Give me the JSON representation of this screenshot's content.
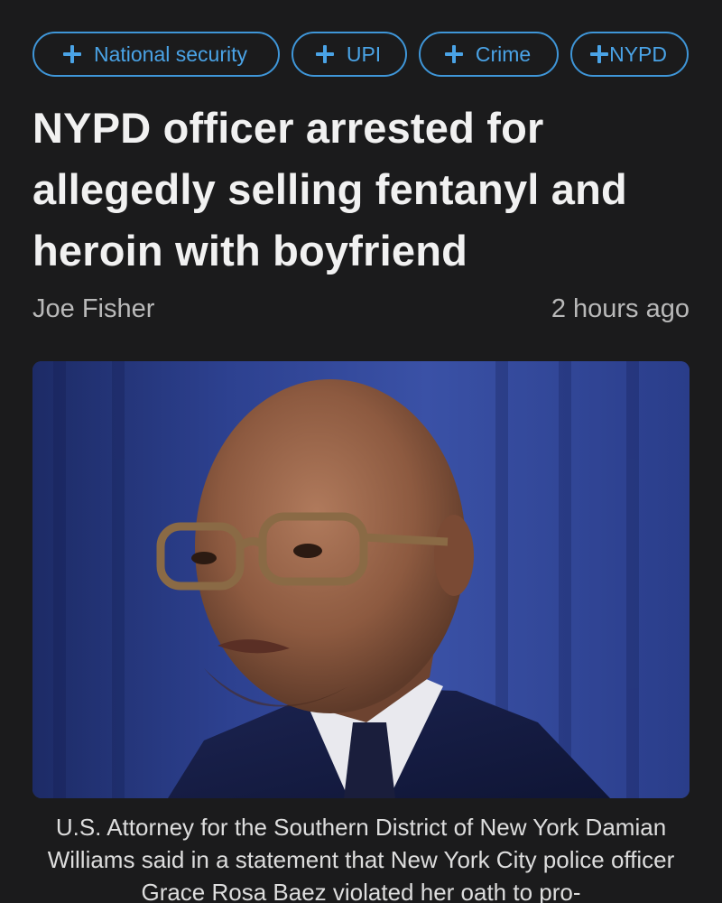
{
  "tags": [
    {
      "label": "National security",
      "icon": "plus-icon"
    },
    {
      "label": "UPI",
      "icon": "plus-icon"
    },
    {
      "label": "Crime",
      "icon": "plus-icon"
    },
    {
      "label": "NYPD",
      "icon": "plus-icon"
    }
  ],
  "article": {
    "headline": "NYPD officer arrested for allegedly selling fentanyl and heroin with boyfriend",
    "author": "Joe Fisher",
    "timestamp": "2 hours ago",
    "caption": "U.S. Attorney for the Southern District of New York Damian Williams said in a statement that New York City police officer Grace Rosa Baez violated her oath to pro-"
  },
  "colors": {
    "background": "#1b1b1c",
    "accent": "#3f96d8",
    "headline": "#f1f1f1",
    "meta": "#b9b9b9"
  }
}
